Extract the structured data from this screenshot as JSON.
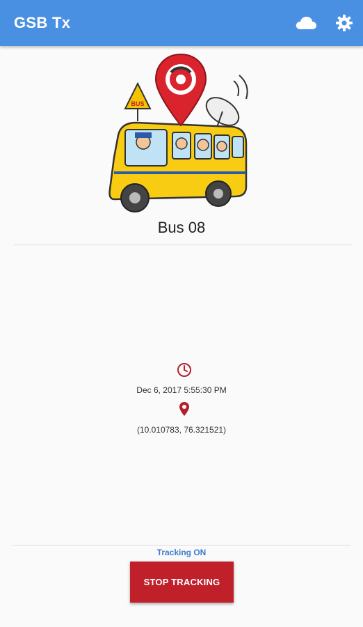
{
  "appbar": {
    "title": "GSB Tx",
    "cloud_icon": "cloud-icon",
    "settings_icon": "gear-icon",
    "color": "#4a90e2"
  },
  "vehicle": {
    "name": "Bus 08"
  },
  "location": {
    "time_icon": "clock-icon",
    "timestamp": "Dec 6, 2017 5:55:30 PM",
    "pin_icon": "location-pin-icon",
    "coordinates": "(10.010783, 76.321521)"
  },
  "tracking": {
    "status": "Tracking ON",
    "button_label": "STOP TRACKING",
    "button_color": "#c0202a"
  }
}
